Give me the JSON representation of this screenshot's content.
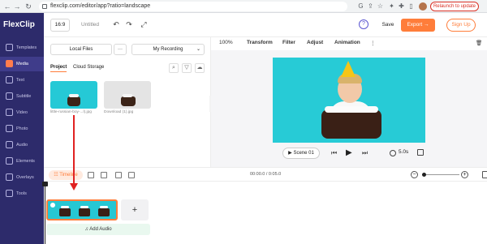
{
  "browser": {
    "url": "flexclip.com/editor/app?ratio=landscape",
    "relaunch_label": "Relaunch to update"
  },
  "sidebar": {
    "logo": "FlexClip",
    "items": [
      {
        "label": "Templates"
      },
      {
        "label": "Media"
      },
      {
        "label": "Text"
      },
      {
        "label": "Subtitle"
      },
      {
        "label": "Video"
      },
      {
        "label": "Photo"
      },
      {
        "label": "Audio"
      },
      {
        "label": "Elements"
      },
      {
        "label": "Overlays"
      },
      {
        "label": "Tools"
      }
    ],
    "active": "Media"
  },
  "topbar": {
    "ratio": "16:9",
    "project_title": "Untitled",
    "save_label": "Save",
    "export_label": "Export",
    "signup_label": "Sign Up"
  },
  "media_panel": {
    "local_files_label": "Local Files",
    "more_label": "···",
    "recording_label": "My Recording",
    "tabs": [
      "Project",
      "Cloud Storage"
    ],
    "files": [
      {
        "name": "little-russian-boy-...l).jpg"
      },
      {
        "name": "Download (1).jpg"
      }
    ]
  },
  "canvas_toolbar": {
    "zoom": "100%",
    "items": [
      "Transform",
      "Filter",
      "Adjust",
      "Animation"
    ]
  },
  "stage": {
    "scene_label": "Scene",
    "scene_number": "01",
    "duration": "5.0s"
  },
  "timeline": {
    "label": "Timeline",
    "time": "00:00.0 / 0:05.0",
    "add_audio_label": "Add Audio",
    "add_clip_label": "+"
  },
  "colors": {
    "sidebar_bg": "#2d2b6b",
    "accent": "#ff7d3a",
    "scene_bg": "#27cbd6",
    "annotation_arrow": "#e02222"
  }
}
